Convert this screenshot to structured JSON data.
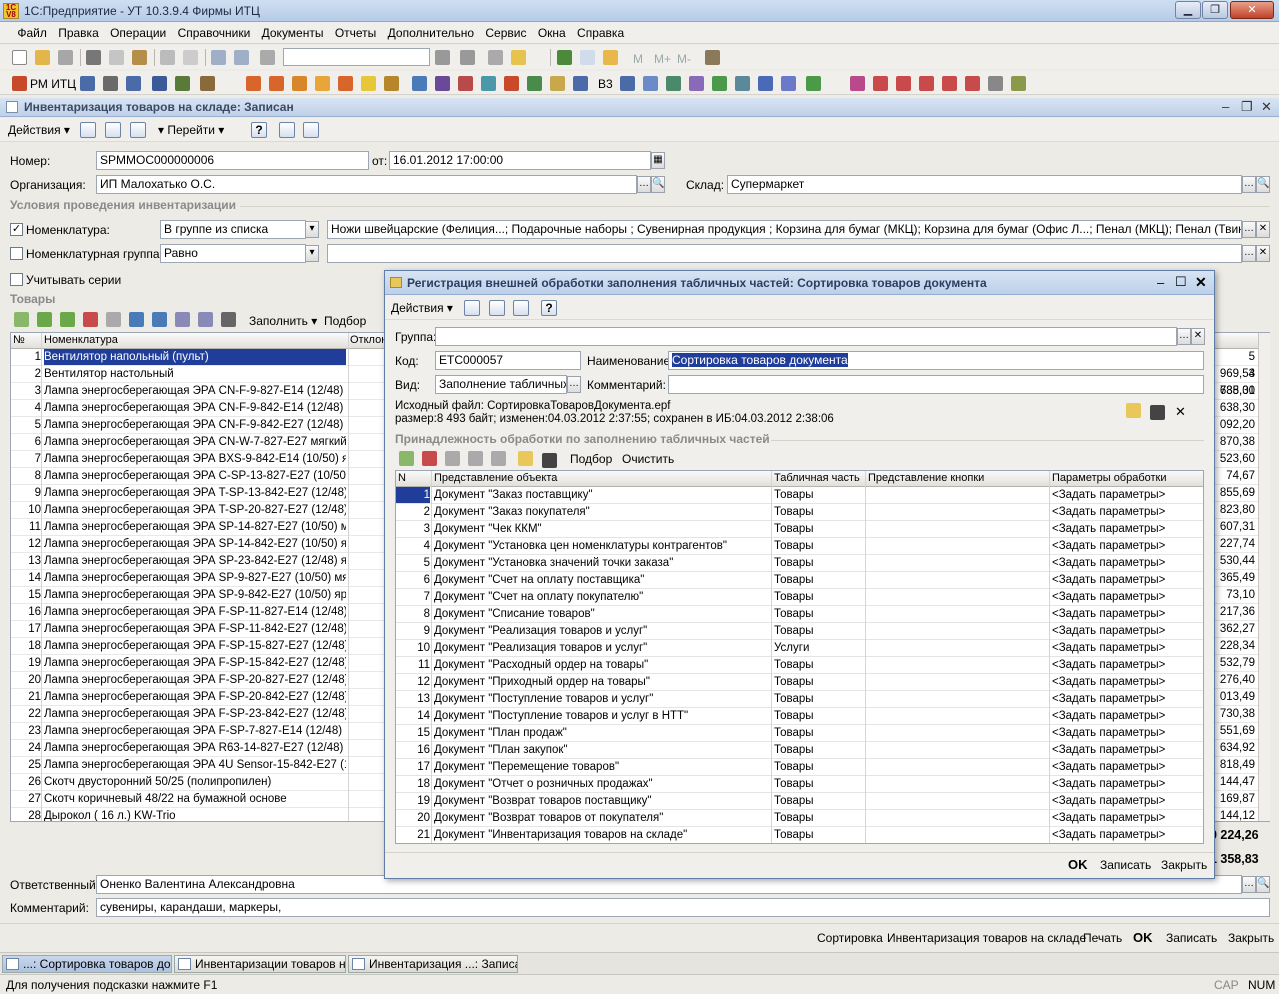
{
  "app": {
    "title": "1С:Предприятие - УТ 10.3.9.4 Фирмы ИТЦ"
  },
  "menu": [
    "Файл",
    "Правка",
    "Операции",
    "Справочники",
    "Документы",
    "Отчеты",
    "Дополнительно",
    "Сервис",
    "Окна",
    "Справка"
  ],
  "toolbar2": {
    "rm_label": "РМ ИТЦ",
    "v3_label": "В3"
  },
  "memory_buttons": [
    "M",
    "M+",
    "M-"
  ],
  "doc": {
    "title": "Инвентаризация товаров на складе: Записан",
    "actions_label": "Действия",
    "goto_label": "Перейти",
    "number_label": "Номер:",
    "number": "SPMMOC000000006",
    "date_label": "от:",
    "date": "16.01.2012 17:00:00",
    "org_label": "Организация:",
    "org": "ИП Малохатько О.С.",
    "warehouse_label": "Склад:",
    "warehouse": "Супермаркет",
    "conditions_title": "Условия проведения инвентаризации",
    "nomen_label": "Номенклатура:",
    "nomen_cond": "В группе из списка",
    "nomen_value": "Ножи швейцарские (Фелиция...; Подарочные наборы ; Сувенирная продукция ; Корзина для бумаг (МКЦ); Корзина для бумаг (Офис Л...; Пенал (МКЦ); Пенал (Твин стар); ПРОДУК",
    "nomen_group_label": "Номенклатурная группа:",
    "nomen_group_cond": "Равно",
    "nomen_group_value": "",
    "series_label": "Учитывать серии",
    "goods_title": "Товары",
    "fill_label": "Заполнить",
    "pick_label": "Подбор",
    "responsible_label": "Ответственный:",
    "responsible": "Оненко Валентина Александровна",
    "comment_label": "Комментарий:",
    "comment": "сувениры, карандаши, маркеры,",
    "totals": [
      "30 224,26",
      "31 358,83"
    ],
    "bottom_buttons": {
      "sort": "Сортировка",
      "inv": "Инвентаризация товаров на складе",
      "print": "Печать",
      "ok": "OK",
      "save": "Записать",
      "close": "Закрыть"
    }
  },
  "goods_table": {
    "headers": [
      "№",
      "Номенклатура",
      "Отклон"
    ],
    "rows": [
      [
        "1",
        "Вентилятор напольный (пульт)"
      ],
      [
        "2",
        "Вентилятор настольный"
      ],
      [
        "3",
        "Лампа энергосберегающая ЭРА CN-F-9-827-E14 (12/48) м..."
      ],
      [
        "4",
        "Лампа энергосберегающая ЭРА CN-F-9-842-E14 (12/48) я..."
      ],
      [
        "5",
        "Лампа энергосберегающая ЭРА CN-F-9-842-E27 (12/48) я..."
      ],
      [
        "6",
        "Лампа энергосберегающая ЭРА CN-W-7-827-E27 мягкий ..."
      ],
      [
        "7",
        "Лампа энергосберегающая ЭРА BXS-9-842-E14 (10/50) я..."
      ],
      [
        "8",
        "Лампа энергосберегающая ЭРА C-SP-13-827-E27 (10/50) ..."
      ],
      [
        "9",
        "Лампа энергосберегающая ЭРА T-SP-13-842-E27 (12/48) ..."
      ],
      [
        "10",
        "Лампа энергосберегающая ЭРА T-SP-20-827-E27 (12/48) ..."
      ],
      [
        "11",
        "Лампа энергосберегающая ЭРА SP-14-827-E27 (10/50) м..."
      ],
      [
        "12",
        "Лампа энергосберегающая ЭРА SP-14-842-E27 (10/50) яр..."
      ],
      [
        "13",
        "Лампа энергосберегающая ЭРА SP-23-842-E27 (12/48) яр..."
      ],
      [
        "14",
        "Лампа энергосберегающая ЭРА SP-9-827-E27 (10/50) мя..."
      ],
      [
        "15",
        "Лампа энергосберегающая ЭРА SP-9-842-E27 (10/50) ярк..."
      ],
      [
        "16",
        "Лампа энергосберегающая ЭРА F-SP-11-827-E14 (12/48) ..."
      ],
      [
        "17",
        "Лампа энергосберегающая ЭРА F-SP-11-842-E27 (12/48) ..."
      ],
      [
        "18",
        "Лампа энергосберегающая ЭРА F-SP-15-827-E27 (12/48) ..."
      ],
      [
        "19",
        "Лампа энергосберегающая ЭРА F-SP-15-842-E27 (12/48) ..."
      ],
      [
        "20",
        "Лампа энергосберегающая ЭРА F-SP-20-827-E27 (12/48) ..."
      ],
      [
        "21",
        "Лампа энергосберегающая ЭРА F-SP-20-842-E27 (12/48) ..."
      ],
      [
        "22",
        "Лампа энергосберегающая ЭРА F-SP-23-842-E27 (12/48) ..."
      ],
      [
        "23",
        "Лампа энергосберегающая ЭРА F-SP-7-827-E14 (12/48) м..."
      ],
      [
        "24",
        "Лампа энергосберегающая ЭРА R63-14-827-E27 (12/48) ..."
      ],
      [
        "25",
        "Лампа энергосберегающая ЭРА 4U Sensor-15-842-E27 (1..."
      ],
      [
        "26",
        "Скотч двусторонний 50/25 (полипропилен)"
      ],
      [
        "27",
        "Скотч коричневый 48/22 на бумажной основе"
      ],
      [
        "28",
        "Дырокол ( 16 л.) KW-Trio"
      ]
    ],
    "sums": [
      "5 969,54",
      "3 785,01",
      "638,30",
      "638,30",
      "092,20",
      "870,38",
      "523,60",
      "74,67",
      "855,69",
      "823,80",
      "607,31",
      "227,74",
      "530,44",
      "365,49",
      "73,10",
      "217,36",
      "362,27",
      "228,34",
      "532,79",
      "276,40",
      "013,49",
      "730,38",
      "551,69",
      "634,92",
      "818,49",
      "144,47",
      "169,87",
      "144,12"
    ]
  },
  "modal": {
    "title": "Регистрация внешней обработки заполнения табличных частей: Сортировка товаров документа",
    "actions_label": "Действия",
    "group_label": "Группа:",
    "group": "",
    "code_label": "Код:",
    "code": "ЕТС000057",
    "name_label": "Наименование:",
    "name": "Сортировка товаров документа",
    "kind_label": "Вид:",
    "kind": "Заполнение табличных ча",
    "comment_label": "Комментарий:",
    "comment": "",
    "file_line1": "Исходный файл: СортировкаТоваровДокумента.epf",
    "file_line2": "размер:8 493 байт; изменен:04.03.2012 2:37:55; сохранен в ИБ:04.03.2012 2:38:06",
    "section_title": "Принадлежность обработки по заполнению табличных частей",
    "pick_label": "Подбор",
    "clear_label": "Очистить",
    "headers": [
      "N",
      "Представление объекта",
      "Табличная часть",
      "Представление кнопки",
      "Параметры обработки"
    ],
    "rows": [
      [
        "1",
        "Документ \"Заказ поставщику\"",
        "Товары",
        "",
        "<Задать параметры>"
      ],
      [
        "2",
        "Документ \"Заказ покупателя\"",
        "Товары",
        "",
        "<Задать параметры>"
      ],
      [
        "3",
        "Документ \"Чек ККМ\"",
        "Товары",
        "",
        "<Задать параметры>"
      ],
      [
        "4",
        "Документ \"Установка цен номенклатуры контрагентов\"",
        "Товары",
        "",
        "<Задать параметры>"
      ],
      [
        "5",
        "Документ \"Установка значений точки заказа\"",
        "Товары",
        "",
        "<Задать параметры>"
      ],
      [
        "6",
        "Документ \"Счет на оплату поставщика\"",
        "Товары",
        "",
        "<Задать параметры>"
      ],
      [
        "7",
        "Документ \"Счет на оплату покупателю\"",
        "Товары",
        "",
        "<Задать параметры>"
      ],
      [
        "8",
        "Документ \"Списание товаров\"",
        "Товары",
        "",
        "<Задать параметры>"
      ],
      [
        "9",
        "Документ \"Реализация товаров и услуг\"",
        "Товары",
        "",
        "<Задать параметры>"
      ],
      [
        "10",
        "Документ \"Реализация товаров и услуг\"",
        "Услуги",
        "",
        "<Задать параметры>"
      ],
      [
        "11",
        "Документ \"Расходный ордер на товары\"",
        "Товары",
        "",
        "<Задать параметры>"
      ],
      [
        "12",
        "Документ \"Приходный ордер на товары\"",
        "Товары",
        "",
        "<Задать параметры>"
      ],
      [
        "13",
        "Документ \"Поступление товаров и услуг\"",
        "Товары",
        "",
        "<Задать параметры>"
      ],
      [
        "14",
        "Документ \"Поступление товаров и услуг в НТТ\"",
        "Товары",
        "",
        "<Задать параметры>"
      ],
      [
        "15",
        "Документ \"План продаж\"",
        "Товары",
        "",
        "<Задать параметры>"
      ],
      [
        "16",
        "Документ \"План закупок\"",
        "Товары",
        "",
        "<Задать параметры>"
      ],
      [
        "17",
        "Документ \"Перемещение товаров\"",
        "Товары",
        "",
        "<Задать параметры>"
      ],
      [
        "18",
        "Документ \"Отчет о розничных продажах\"",
        "Товары",
        "",
        "<Задать параметры>"
      ],
      [
        "19",
        "Документ \"Возврат товаров поставщику\"",
        "Товары",
        "",
        "<Задать параметры>"
      ],
      [
        "20",
        "Документ \"Возврат товаров от покупателя\"",
        "Товары",
        "",
        "<Задать параметры>"
      ],
      [
        "21",
        "Документ \"Инвентаризация товаров на складе\"",
        "Товары",
        "",
        "<Задать параметры>"
      ]
    ],
    "ok": "OK",
    "save": "Записать",
    "close": "Закрыть"
  },
  "taskbar": [
    "...: Сортировка товаров док...",
    "Инвентаризации товаров н...",
    "Инвентаризация ...: Записан"
  ],
  "status": {
    "hint": "Для получения подсказки нажмите F1",
    "cap": "CAP",
    "num": "NUM"
  },
  "colors": {
    "selection": "#1f3d99",
    "titlebar": "#bcd0ea"
  }
}
